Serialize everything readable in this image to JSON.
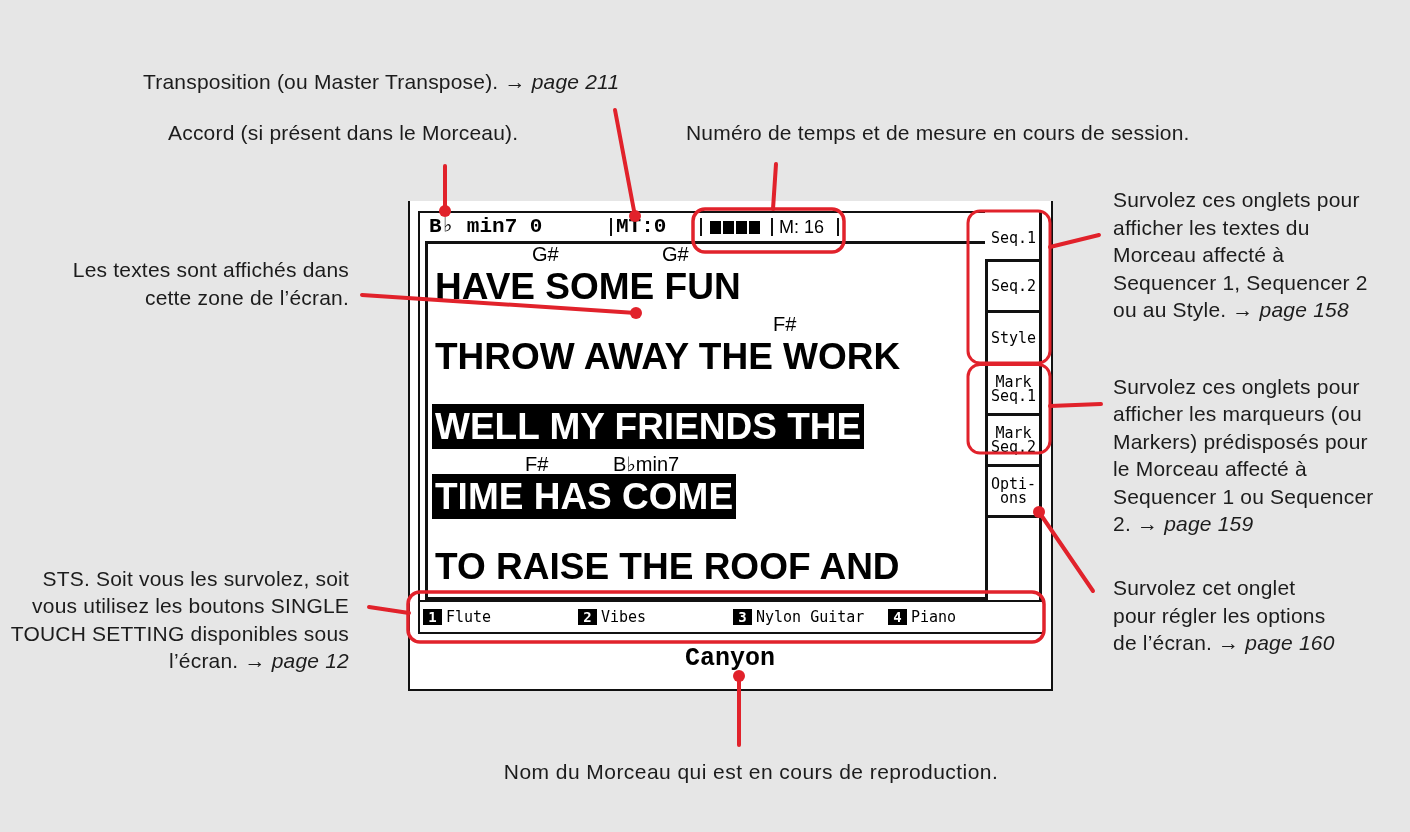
{
  "top_notes": [
    {
      "lines": [
        "Transposition (ou Master Transpose). → *page 211*"
      ]
    },
    {
      "lines": [
        "Accord (si présent dans le Morceau)."
      ]
    },
    {
      "lines": [
        "Numéro de temps et de mesure en cours de session."
      ]
    }
  ],
  "left_notes": [
    {
      "lines": [
        "Les textes sont affichés dans",
        "cette zone de l’écran."
      ]
    },
    {
      "lines": [
        "STS. Soit vous les survolez, soit",
        "vous utilisez les boutons SINGLE",
        "TOUCH SETTING disponibles sous",
        "l’écran. → *page 12*"
      ]
    }
  ],
  "lcd": {
    "header": {
      "chord": "B♭ min7 0",
      "transpose": "MT:0",
      "beats": [
        {
          "on": true
        },
        {
          "on": true
        },
        {
          "on": true
        },
        {
          "on": true
        }
      ],
      "measure": "M: 16"
    },
    "lyrics": [
      {
        "chords": [
          "G#",
          "G#"
        ],
        "text": "HAVE SOME FUN",
        "highlighted": false
      },
      {
        "chords": [
          "F#"
        ],
        "text": "THROW AWAY THE WORK",
        "highlighted": false
      },
      {
        "text": "WELL MY FRIENDS THE",
        "highlighted": true
      },
      {
        "chords": [
          "F#",
          "B♭min7"
        ],
        "text": "TIME HAS COME",
        "highlighted": true
      },
      {
        "text": "TO RAISE THE ROOF AND",
        "highlighted": false
      }
    ],
    "tabs": [
      {
        "lines": [
          "Seq.1"
        ],
        "selected": true
      },
      {
        "lines": [
          "Seq.2"
        ],
        "selected": false
      },
      {
        "lines": [
          "Style"
        ],
        "selected": false
      },
      {
        "lines": [
          "Mark",
          "Seq.1"
        ],
        "selected": false
      },
      {
        "lines": [
          "Mark",
          "Seq.2"
        ],
        "selected": false
      },
      {
        "lines": [
          "Opti-",
          "ons"
        ],
        "selected": false
      }
    ],
    "sts": [
      {
        "number": "1",
        "name": "Flute"
      },
      {
        "number": "2",
        "name": "Vibes"
      },
      {
        "number": "3",
        "name": "Nylon Guitar"
      },
      {
        "number": "4",
        "name": "Piano"
      }
    ],
    "song_name": "Canyon"
  },
  "right_notes": [
    {
      "lines": [
        "Survolez ces onglets pour",
        "afficher les textes du",
        "Morceau affecté à",
        "Sequencer 1, Sequencer 2",
        "ou au Style. → *page 158*"
      ]
    },
    {
      "lines": [
        "Survolez ces onglets pour",
        "afficher les marqueurs (ou",
        "Markers) prédisposés pour",
        "le Morceau affecté à",
        "Sequencer 1 ou Sequencer",
        "2. → *page 159*"
      ]
    },
    {
      "lines": [
        "Survolez cet onglet",
        "pour régler les options",
        "de l’écran. → *page 160*"
      ]
    }
  ],
  "bottom_note": {
    "lines": [
      "Nom du Morceau qui est en cours de reproduction."
    ]
  }
}
